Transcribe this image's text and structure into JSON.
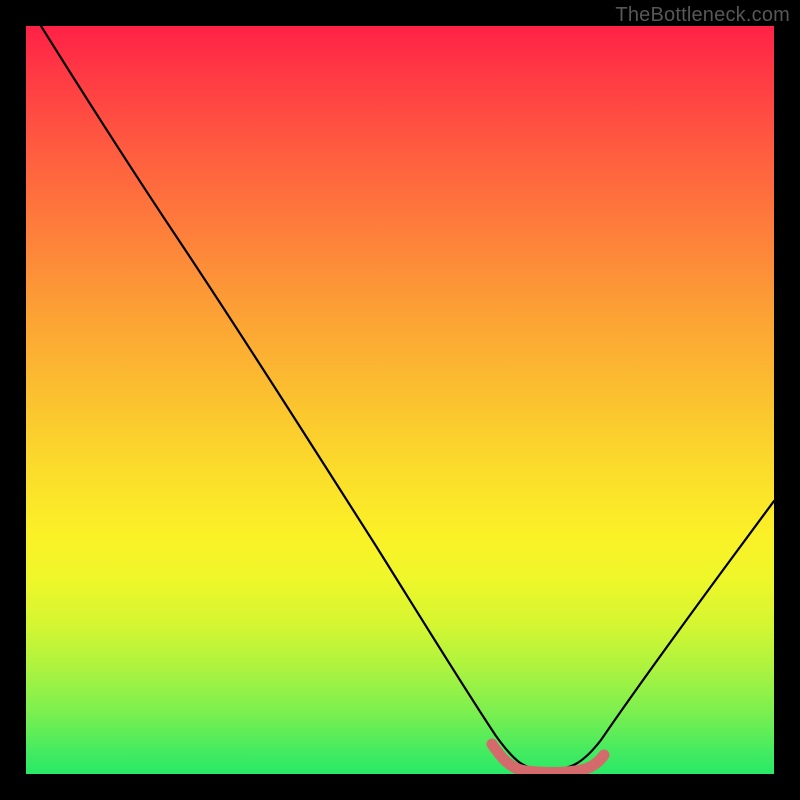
{
  "domain": "Chart",
  "watermark": "TheBottleneck.com",
  "colors": {
    "frame_bg": "#000000",
    "gradient_top": "#ff2147",
    "gradient_bottom": "#28e968",
    "curve": "#000000",
    "min_marker": "#d56a6c",
    "watermark": "#575757"
  },
  "chart_data": {
    "type": "line",
    "title": "",
    "xlabel": "",
    "ylabel": "",
    "x": [
      2,
      4,
      8,
      12,
      16,
      20,
      24,
      28,
      32,
      36,
      40,
      44,
      48,
      52,
      56,
      60,
      63,
      66,
      70,
      74,
      78,
      82,
      86,
      90,
      94,
      98,
      100
    ],
    "values": [
      100,
      98,
      93,
      87,
      81,
      75,
      69,
      63,
      57,
      51,
      44,
      38,
      31,
      24,
      17,
      10,
      5,
      2,
      1,
      1,
      2,
      5,
      10,
      16,
      22,
      28,
      31
    ],
    "xlim": [
      0,
      100
    ],
    "ylim": [
      0,
      100
    ],
    "min_region_x": [
      62,
      76
    ],
    "notes": "V-shaped bottleneck curve on rainbow gradient; pink marker indicates minimum region around x≈62–76"
  }
}
